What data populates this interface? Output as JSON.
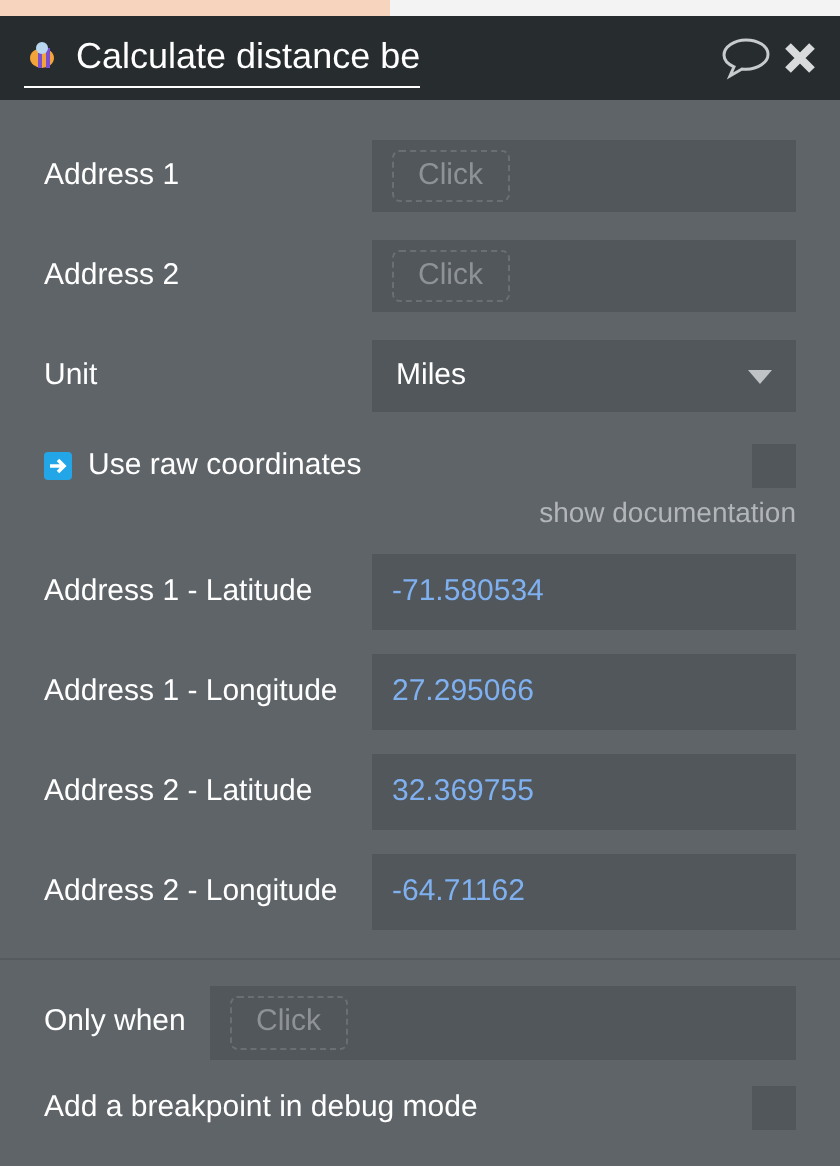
{
  "header": {
    "title": "Calculate distance be"
  },
  "fields": [
    {
      "kind": "dynamic",
      "label": "Address 1",
      "placeholder": "Click"
    },
    {
      "kind": "dynamic",
      "label": "Address 2",
      "placeholder": "Click"
    },
    {
      "kind": "dropdown",
      "label": "Unit",
      "value": "Miles"
    }
  ],
  "raw_coordinates": {
    "label": "Use raw coordinates",
    "checked": false,
    "link": "show documentation"
  },
  "coordinates": [
    {
      "label": "Address 1 - Latitude",
      "value": "-71.580534"
    },
    {
      "label": "Address 1 - Longitude",
      "value": "27.295066"
    },
    {
      "label": "Address 2 - Latitude",
      "value": "32.369755"
    },
    {
      "label": "Address 2 - Longitude",
      "value": "-64.71162"
    }
  ],
  "only_when": {
    "label": "Only when",
    "placeholder": "Click"
  },
  "breakpoint": {
    "label": "Add a breakpoint in debug mode",
    "checked": false
  }
}
